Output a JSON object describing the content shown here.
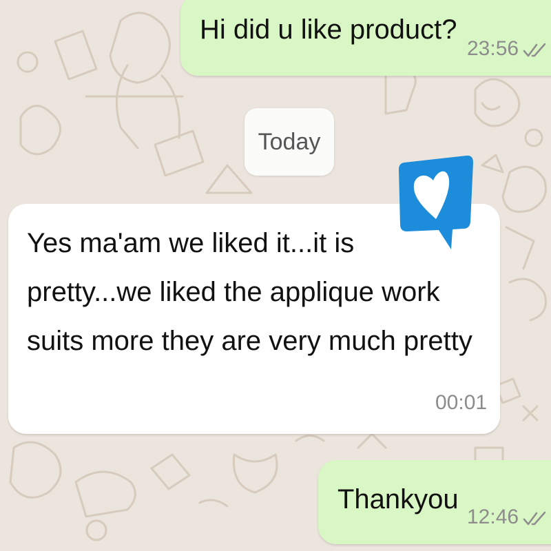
{
  "chat": {
    "date_separator": "Today",
    "messages": [
      {
        "direction": "outgoing",
        "text": "Hi did u like product?",
        "time": "23:56",
        "status_icon": "double-check-icon"
      },
      {
        "direction": "incoming",
        "lines": [
          "Yes ma'am we liked it...it is",
          "pretty...we liked the applique work",
          "suits more they are very much pretty"
        ],
        "time": "00:01"
      },
      {
        "direction": "outgoing",
        "text": "Thankyou",
        "time": "12:46",
        "status_icon": "double-check-icon"
      }
    ],
    "sticker": {
      "icon": "heart-speech-bubble-icon",
      "color": "#1d8ddb"
    }
  },
  "colors": {
    "wallpaper": "#ece5dd",
    "outgoing_bubble": "#d9f7c5",
    "incoming_bubble": "#ffffff",
    "meta_text": "#8c8c8c"
  }
}
